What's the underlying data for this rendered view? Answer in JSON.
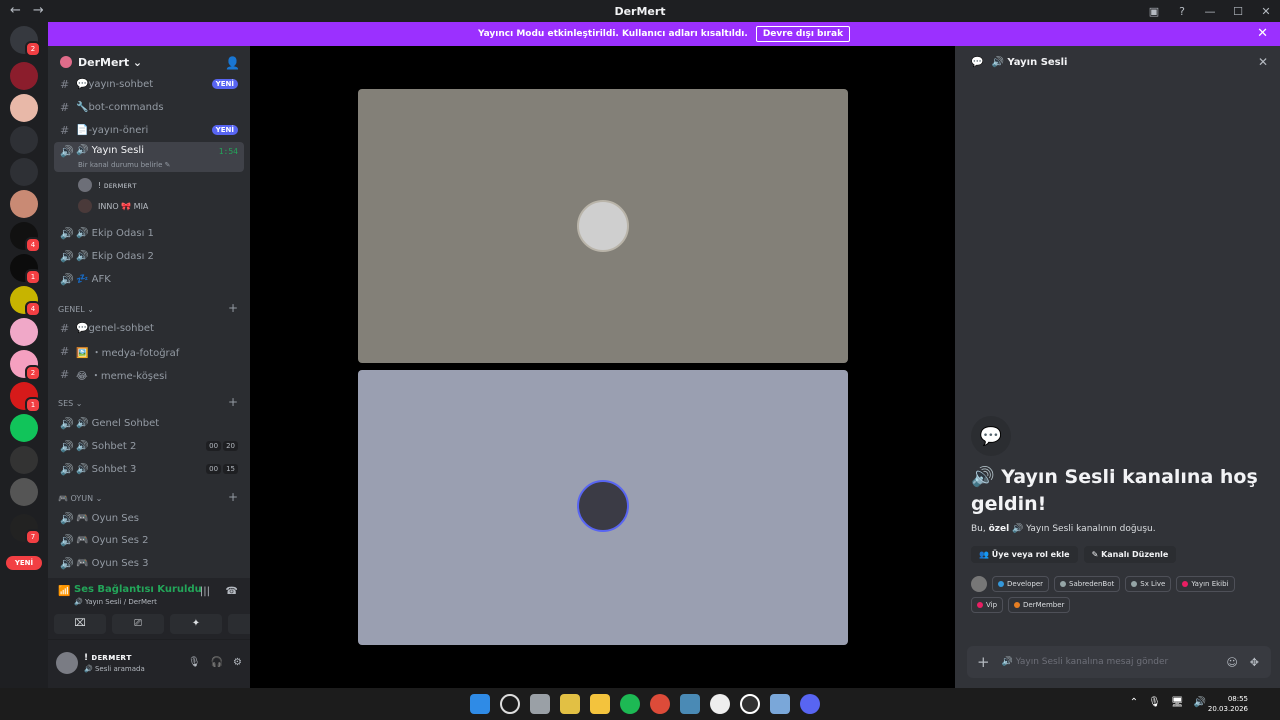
{
  "window": {
    "title": "DerMert",
    "back": "←",
    "forward": "→"
  },
  "banner": {
    "text": "Yayıncı Modu etkinleştirildi. Kullanıcı adları kısaltıldı.",
    "button": "Devre dışı bırak",
    "close": "✕"
  },
  "guilds": {
    "new_label": "YENİ",
    "badges": [
      "2",
      "4",
      "1",
      "4",
      "2",
      "1",
      "7"
    ]
  },
  "server": {
    "name": "DerMert ⌄"
  },
  "channels": [
    {
      "icon": "#",
      "label": "💬yayın-sohbet",
      "tag": "YENİ"
    },
    {
      "icon": "#",
      "label": "🔧bot-commands",
      "tag": ""
    },
    {
      "icon": "#",
      "label": "📄-yayın-öneri",
      "tag": "YENİ"
    }
  ],
  "active_channel": {
    "label": "🔊 Yayın Sesli",
    "sub": "Bir kanal durumu belirle ✎",
    "timer": "1:54"
  },
  "voice_users": [
    {
      "name": "! ᴅᴇʀᴍᴇʀᴛ"
    },
    {
      "name": "INNO 🎀 MIA"
    }
  ],
  "voice_channels": [
    "🔊 Ekip Odası 1",
    "🔊 Ekip Odası 2",
    "💤 AFK"
  ],
  "cat_genel": "GENEL ⌄",
  "genel_channels": [
    "💬genel-sohbet",
    "🖼️ ・medya-fotoğraf",
    "😂 ・meme-köşesi"
  ],
  "cat_ses": "SES ⌄",
  "ses_channels": [
    {
      "label": "🔊 Genel Sohbet",
      "a": "",
      "b": ""
    },
    {
      "label": "🔊 Sohbet 2",
      "a": "00",
      "b": "20"
    },
    {
      "label": "🔊 Sohbet 3",
      "a": "00",
      "b": "15"
    }
  ],
  "cat_oyun": "🎮 OYUN ⌄",
  "oyun_channels": [
    "🎮 Oyun Ses",
    "🎮 Oyun Ses 2",
    "🎮 Oyun Ses 3"
  ],
  "voice_panel": {
    "status": "Ses Bağlantısı Kuruldu",
    "sub": "🔊 Yayın Sesli / DerMert"
  },
  "user_panel": {
    "name": "! ᴅᴇʀᴍᴇʀᴛ",
    "status": "🔊 Sesli aramada"
  },
  "right_panel": {
    "title": "🔊 Yayın Sesli",
    "welcome": "🔊 Yayın Sesli kanalına hoş geldin!",
    "desc_prefix": "Bu, ",
    "desc_bold": "özel",
    "desc_suffix": " 🔊 Yayın Sesli kanalının doğuşu.",
    "btn_add": "👥 Üye veya rol ekle",
    "btn_edit": "✎ Kanalı Düzenle",
    "roles": [
      {
        "name": "Developer",
        "color": "#3498db"
      },
      {
        "name": "SabredenBot",
        "color": "#95a5a6"
      },
      {
        "name": "Sx Live",
        "color": "#95a5a6"
      },
      {
        "name": "Yayın Ekibi",
        "color": "#e91e63"
      },
      {
        "name": "Vip",
        "color": "#e91e63"
      },
      {
        "name": "DerMember",
        "color": "#e67e22"
      }
    ],
    "message_placeholder": "🔊 Yayın Sesli kanalına mesaj gönder"
  },
  "clock": {
    "time": "08:55",
    "date": "20.03.2026"
  }
}
